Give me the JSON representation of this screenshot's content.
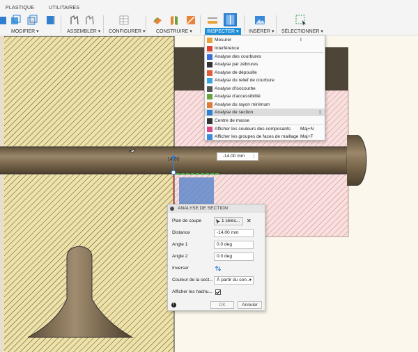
{
  "ribbon": {
    "tabs": [
      "PLASTIQUE",
      "UTILITAIRES"
    ],
    "groups": {
      "modify": "MODIFIER ▾",
      "assemble": "ASSEMBLER ▾",
      "configure": "CONFIGURER ▾",
      "construct": "CONSTRUIRE ▾",
      "inspect": "INSPECTER ▾",
      "insert": "INSÉRER ▾",
      "select": "SÉLECTIONNER ▾"
    }
  },
  "inspect_menu": {
    "items": [
      {
        "label": "Mesurer",
        "shortcut": "I",
        "icon": "ruler-icon",
        "color": "#e8a33c"
      },
      {
        "label": "Interférence",
        "shortcut": "",
        "icon": "interference-icon",
        "color": "#d9433a"
      },
      {
        "label": "Analyse des courbures",
        "shortcut": "",
        "icon": "curvature-comb-icon",
        "color": "#3a6fd9"
      },
      {
        "label": "Analyse par zébrures",
        "shortcut": "",
        "icon": "zebra-icon",
        "color": "#333333"
      },
      {
        "label": "Analyse de dépouille",
        "shortcut": "",
        "icon": "draft-analysis-icon",
        "color": "#e05c3a"
      },
      {
        "label": "Analyse du relief de courbure",
        "shortcut": "",
        "icon": "curvature-map-icon",
        "color": "#3aa6d9"
      },
      {
        "label": "Analyse d'isocourbe",
        "shortcut": "",
        "icon": "isocurve-icon",
        "color": "#555555"
      },
      {
        "label": "Analyse d'accessibilité",
        "shortcut": "",
        "icon": "accessibility-icon",
        "color": "#6aa33c"
      },
      {
        "label": "Analyse du rayon minimum",
        "shortcut": "",
        "icon": "min-radius-icon",
        "color": "#e07a3a"
      },
      {
        "label": "Analyse de section",
        "shortcut": "",
        "icon": "section-analysis-icon",
        "color": "#2f7fd1"
      },
      {
        "label": "Centre de masse",
        "shortcut": "",
        "icon": "center-of-mass-icon",
        "color": "#333333"
      },
      {
        "label": "Afficher les couleurs des composants",
        "shortcut": "Maj+N",
        "icon": "component-colors-icon",
        "color": "#d94a8a"
      },
      {
        "label": "Afficher les groupes de faces de maillage",
        "shortcut": "Maj+F",
        "icon": "mesh-face-groups-icon",
        "color": "#3a8ad9"
      }
    ],
    "more_glyph": "⋮"
  },
  "distance_tag": {
    "value": "-14.00 mm",
    "menu_glyph": "⋮"
  },
  "section_panel": {
    "title": "ANALYSE DE SECTION",
    "rows": {
      "plane_label": "Plan de coupe",
      "plane_value": "1 sélec...",
      "distance_label": "Distance",
      "distance_value": "-14.00 mm",
      "angle1_label": "Angle 1",
      "angle1_value": "0.0 deg",
      "angle2_label": "Angle 2",
      "angle2_value": "0.0 deg",
      "flip_label": "Inverser",
      "color_label": "Couleur de la sect...",
      "color_value": "À partir du con...",
      "hatch_label": "Afficher les hachu..."
    },
    "ok": "OK",
    "cancel": "Annuler",
    "close_glyph": "✕",
    "info_glyph": "i"
  },
  "colors": {
    "accent": "#1e8fd8",
    "shaft": "#7d6a4f",
    "hatch_red": "#d46a6a",
    "section_blue": "#4f7fc9"
  }
}
